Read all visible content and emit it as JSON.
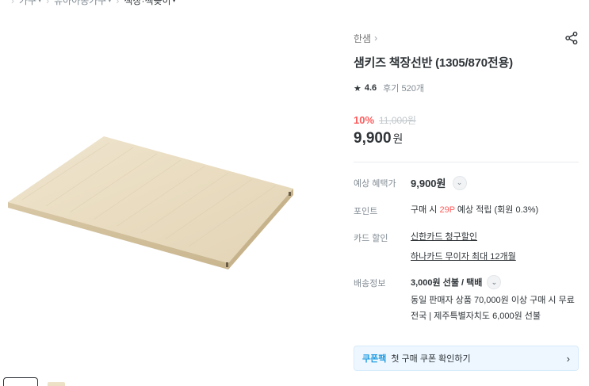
{
  "breadcrumb": {
    "items": [
      "가구",
      "유아아동가구",
      "책장·책꽂이"
    ]
  },
  "product": {
    "brand": "한샘",
    "brand_chevron": "›",
    "title": "샘키즈 책장선반 (1305/870전용)",
    "rating_star": "★",
    "rating": "4.6",
    "reviews": "후기 520개",
    "discount": "10%",
    "original_price": "11,000원",
    "price": "9,900",
    "price_unit": "원"
  },
  "details": {
    "benefit_label": "예상 혜택가",
    "benefit_value": "9,900원",
    "point_label": "포인트",
    "point_prefix": "구매 시 ",
    "point_amount": "29P",
    "point_suffix": " 예상 적립 (회원 0.3%)",
    "card_label": "카드 할인",
    "card_links": [
      "신한카드 청구할인",
      "하나카드 무이자 최대 12개월"
    ],
    "shipping_label": "배송정보",
    "shipping_main": "3,000원 선불 / 택배",
    "shipping_note": "동일 판매자 상품 70,000원 이상 구매 시 무료",
    "shipping_extra": "전국 | 제주특별자치도 6,000원 선불"
  },
  "coupon": {
    "tag": "쿠폰팩",
    "text": "첫 구매 쿠폰 확인하기",
    "arrow": "›"
  },
  "icons": {
    "share": "share-icon",
    "chevron_down": "chevron-down-icon",
    "star": "star-icon"
  },
  "colors": {
    "discount": "#ff5c5c",
    "coupon_bg": "#eef7ff",
    "coupon_tag": "#1f9be0"
  }
}
